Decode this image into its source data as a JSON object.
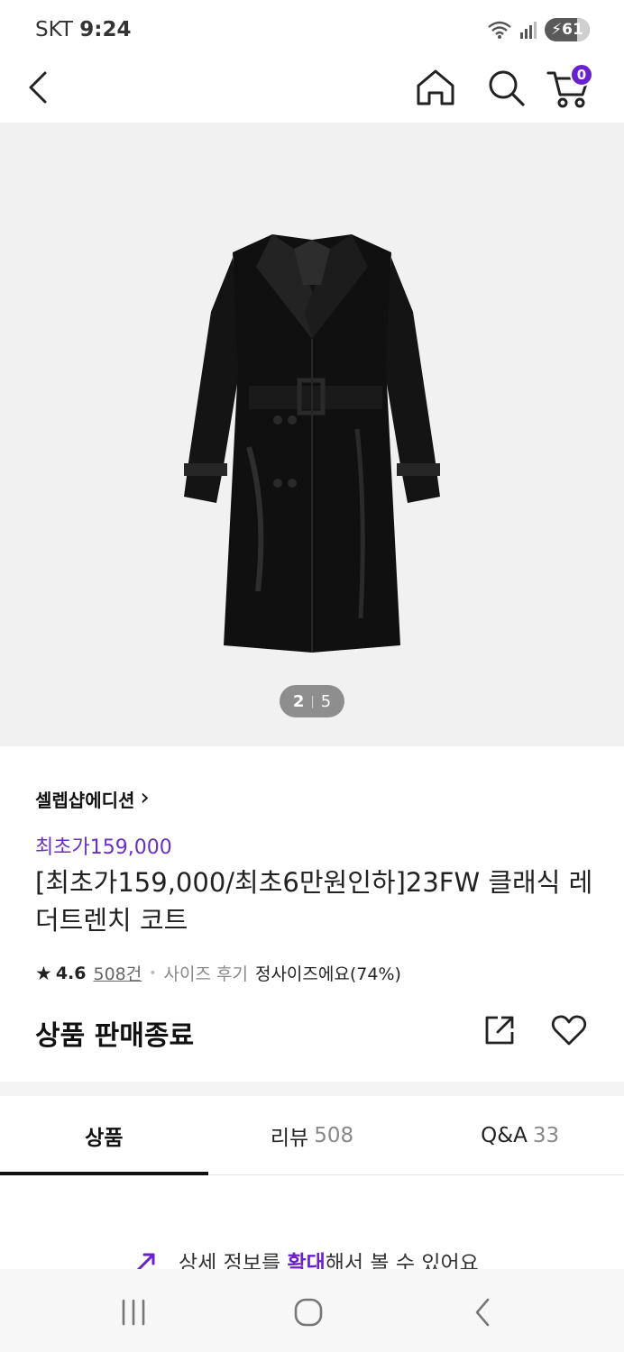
{
  "status_bar": {
    "carrier": "SKT",
    "time": "9:24",
    "battery": "61"
  },
  "top_nav": {
    "cart_count": "0",
    "icons": [
      "back-arrow-icon",
      "home-icon",
      "search-icon",
      "cart-icon"
    ]
  },
  "product_image": {
    "current": "2",
    "total": "5",
    "separator": "|"
  },
  "product": {
    "brand": "셀렙샵에디션",
    "brand_chevron": "›",
    "promo": "최초가159,000",
    "title": "[최초가159,000/최초6만원인하]23FW 클래식 레더트렌치 코트",
    "rating_star": "★",
    "rating": "4.6",
    "review_count": "508건",
    "size_review_label": "사이즈 후기",
    "size_review_value": "정사이즈에요(74%)",
    "sale_status": "상품 판매종료"
  },
  "tabs": [
    {
      "label": "상품",
      "count": ""
    },
    {
      "label": "리뷰",
      "count": "508"
    },
    {
      "label": "Q&A",
      "count": "33"
    }
  ],
  "zoom_hint": {
    "prefix": "상세 정보를",
    "highlight": "확대",
    "suffix": "해서 볼 수 있어요"
  },
  "colors": {
    "accent": "#6a1fd0",
    "promo": "#6a2fc4",
    "image_bg": "#f1f1f1"
  }
}
